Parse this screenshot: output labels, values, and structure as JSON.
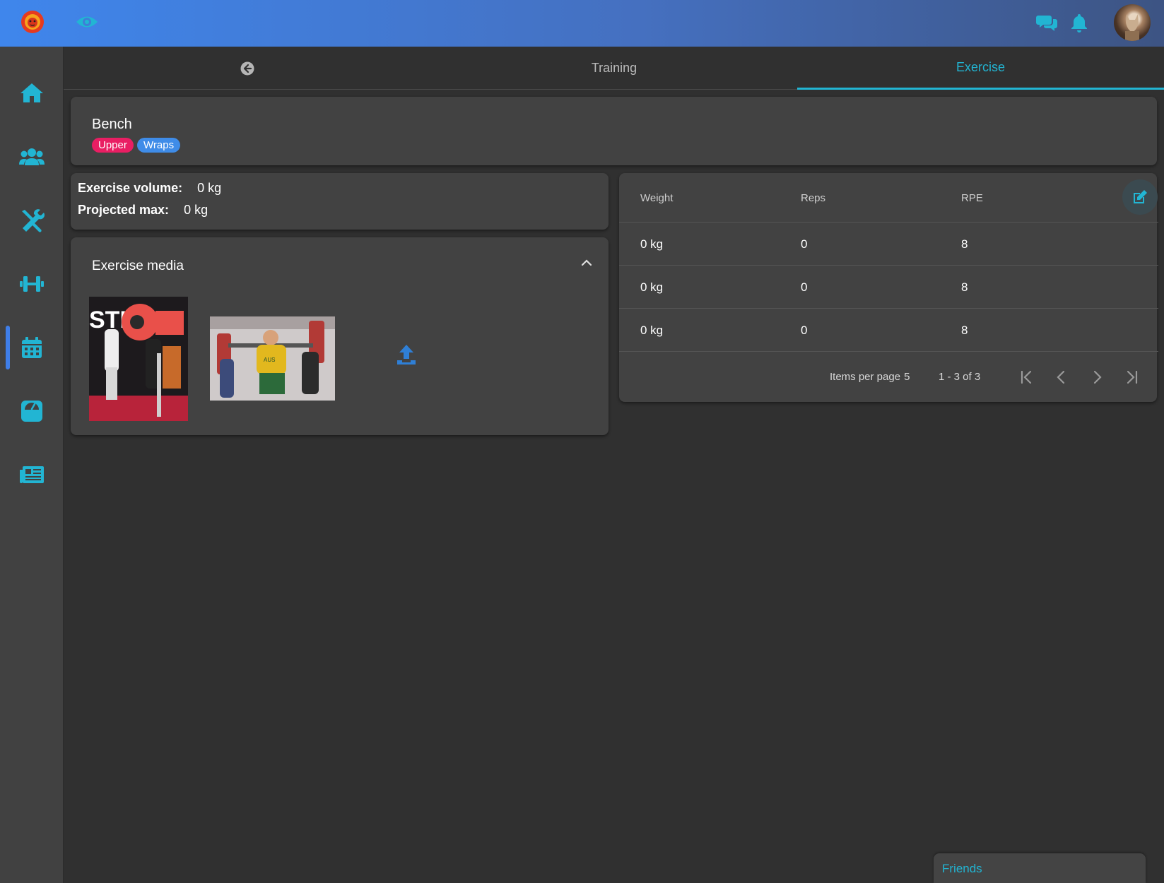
{
  "tabs": {
    "back_icon": "arrow-left-circle-icon",
    "training": "Training",
    "exercise": "Exercise"
  },
  "header": {
    "logo_icon": "lion-logo-icon",
    "eye_icon": "eye-icon",
    "chat_icon": "chat-icon",
    "bell_icon": "bell-icon",
    "avatar": "user-avatar"
  },
  "sidebar": {
    "items": [
      {
        "icon": "home-icon"
      },
      {
        "icon": "users-icon"
      },
      {
        "icon": "tools-icon"
      },
      {
        "icon": "dumbbell-icon"
      },
      {
        "icon": "calendar-icon",
        "active": true
      },
      {
        "icon": "scale-icon"
      },
      {
        "icon": "newspaper-icon"
      }
    ]
  },
  "exercise": {
    "name": "Bench",
    "tags": [
      {
        "label": "Upper",
        "color": "#e91e63"
      },
      {
        "label": "Wraps",
        "color": "#3f8ce8"
      }
    ]
  },
  "stats": {
    "volume_label": "Exercise volume:",
    "volume_value": "0 kg",
    "max_label": "Projected max:",
    "max_value": "0 kg"
  },
  "media": {
    "title": "Exercise media",
    "upload_icon": "upload-icon",
    "collapse_icon": "chevron-up-icon"
  },
  "sets_table": {
    "columns": [
      "Weight",
      "Reps",
      "RPE"
    ],
    "rows": [
      {
        "weight": "0 kg",
        "reps": "0",
        "rpe": "8"
      },
      {
        "weight": "0 kg",
        "reps": "0",
        "rpe": "8"
      },
      {
        "weight": "0 kg",
        "reps": "0",
        "rpe": "8"
      }
    ],
    "edit_icon": "edit-icon"
  },
  "paginator": {
    "items_per_page_label": "Items per page",
    "items_per_page": "5",
    "range": "1 - 3 of 3"
  },
  "friends": {
    "label": "Friends"
  },
  "colors": {
    "accent": "#22b5d3",
    "active_indicator": "#3f7ee8",
    "upload": "#2f7fd6"
  }
}
